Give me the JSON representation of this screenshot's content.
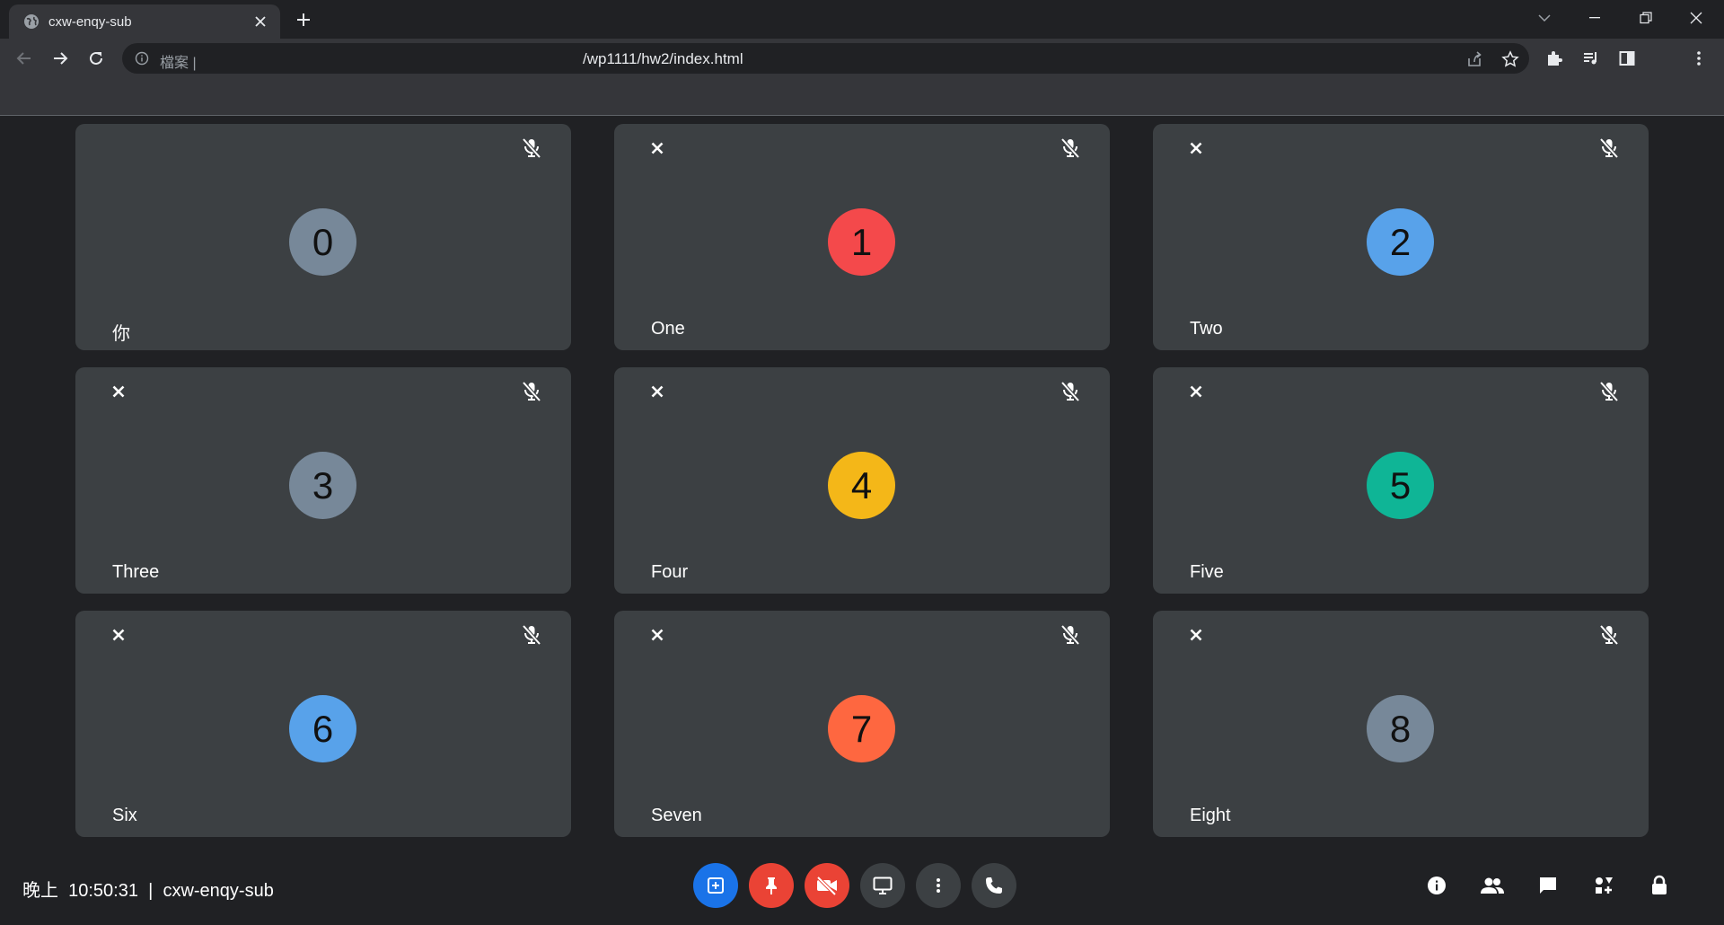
{
  "browser": {
    "tab_title": "cxw-enqy-sub",
    "address_label": "檔案 |",
    "address_url": "/wp1111/hw2/index.html"
  },
  "participants": [
    {
      "number": "0",
      "name": "你",
      "color": "#778899",
      "closable": false,
      "muted": true
    },
    {
      "number": "1",
      "name": "One",
      "color": "#f4494b",
      "closable": true,
      "muted": true
    },
    {
      "number": "2",
      "name": "Two",
      "color": "#58a2ea",
      "closable": true,
      "muted": true
    },
    {
      "number": "3",
      "name": "Three",
      "color": "#778899",
      "closable": true,
      "muted": true
    },
    {
      "number": "4",
      "name": "Four",
      "color": "#f4b718",
      "closable": true,
      "muted": true
    },
    {
      "number": "5",
      "name": "Five",
      "color": "#0fb596",
      "closable": true,
      "muted": true
    },
    {
      "number": "6",
      "name": "Six",
      "color": "#58a2ea",
      "closable": true,
      "muted": true
    },
    {
      "number": "7",
      "name": "Seven",
      "color": "#fe6740",
      "closable": true,
      "muted": true
    },
    {
      "number": "8",
      "name": "Eight",
      "color": "#778899",
      "closable": true,
      "muted": true
    }
  ],
  "bottom_bar": {
    "time_of_day": "晚上",
    "time": "10:50:31",
    "separator": "|",
    "meeting_code": "cxw-enqy-sub",
    "controls": [
      {
        "name": "present-button",
        "icon": "add-box-icon",
        "color": "#1a73e8"
      },
      {
        "name": "pin-button",
        "icon": "pin-icon",
        "color": "#ea4335"
      },
      {
        "name": "camera-off-button",
        "icon": "videocam-off-icon",
        "color": "#ea4335"
      },
      {
        "name": "screen-share-button",
        "icon": "monitor-icon",
        "color": "#3c4043"
      },
      {
        "name": "more-options-button",
        "icon": "more-vert-icon",
        "color": "#3c4043"
      },
      {
        "name": "leave-call-button",
        "icon": "phone-icon",
        "color": "#3c4043"
      }
    ],
    "right_icons": [
      "info-icon",
      "people-icon",
      "chat-icon",
      "activities-icon",
      "lock-icon"
    ]
  }
}
